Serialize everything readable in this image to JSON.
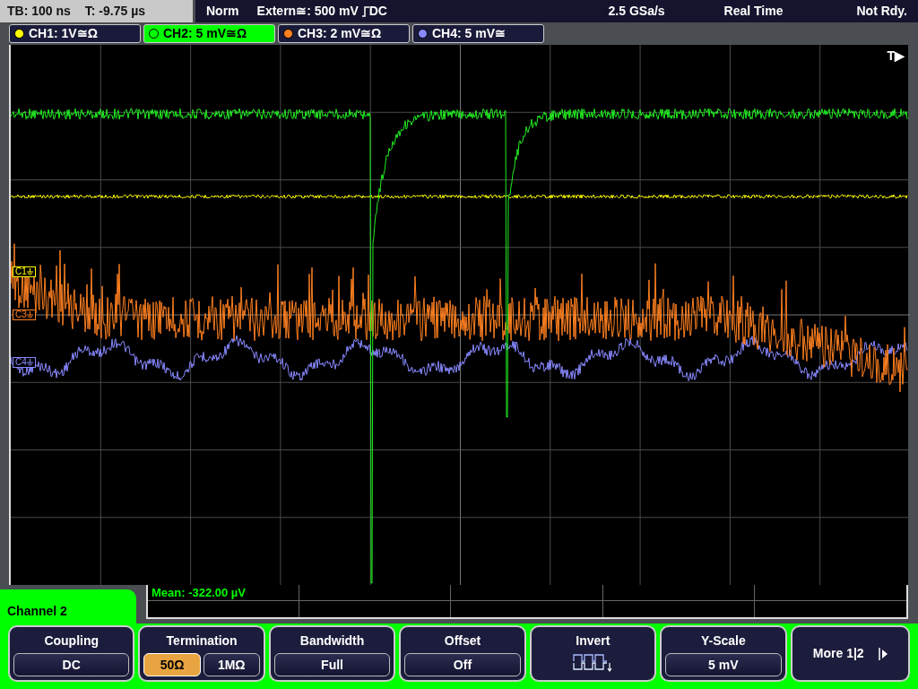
{
  "status_bar": {
    "timebase": "TB: 100 ns",
    "trigger_time": "T: -9.75 µs",
    "mode": "Norm",
    "trigger_source": "Extern≅: 500 mV",
    "trigger_coupling": "DC",
    "sample_rate": "2.5 GSa/s",
    "acquisition": "Real Time",
    "status": "Not Rdy."
  },
  "channels": [
    {
      "label": "CH1: 1V≅Ω",
      "color": "#ffff00",
      "selected": false
    },
    {
      "label": "CH2: 5 mV≅Ω",
      "color": "#00ff00",
      "selected": true
    },
    {
      "label": "CH3: 2 mV≅Ω",
      "color": "#ff8020",
      "selected": false
    },
    {
      "label": "CH4: 5 mV≅",
      "color": "#8888ff",
      "selected": false
    }
  ],
  "trigger_marker": "T▶",
  "waveform_markers": [
    {
      "label": "C1",
      "color": "#ffff00"
    },
    {
      "label": "C3",
      "color": "#ff8020"
    },
    {
      "label": "C4",
      "color": "#8888ff"
    }
  ],
  "measurement": "Mean: -322.00 µV",
  "menu_title": "Channel 2",
  "softkeys": [
    {
      "kind": "value",
      "label": "Coupling",
      "value": "DC"
    },
    {
      "kind": "toggle",
      "label": "Termination",
      "options": [
        {
          "label": "50Ω",
          "selected": true
        },
        {
          "label": "1MΩ",
          "selected": false
        }
      ]
    },
    {
      "kind": "value",
      "label": "Bandwidth",
      "value": "Full"
    },
    {
      "kind": "value",
      "label": "Offset",
      "value": "Off"
    },
    {
      "kind": "icon",
      "label": "Invert"
    },
    {
      "kind": "value",
      "label": "Y-Scale",
      "value": "5 mV"
    },
    {
      "kind": "more",
      "label": "More 1|2"
    }
  ]
}
